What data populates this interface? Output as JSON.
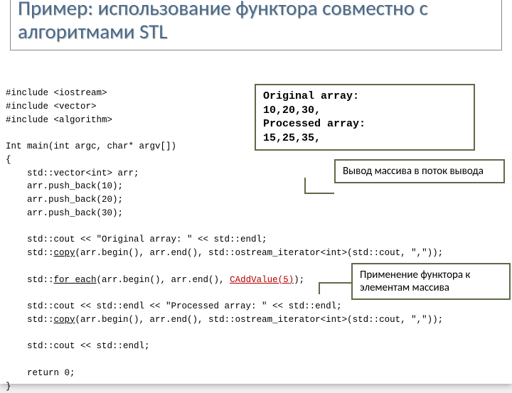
{
  "title": "Пример: использование функтора совместно с алгоритмами STL",
  "code": {
    "inc1": "#include <iostream>",
    "inc2": "#include <vector>",
    "inc3": "#include <algorithm>",
    "mainSig": "Int main(int argc, char* argv[])",
    "braceOpen": "{",
    "l1": "    std::vector<int> arr;",
    "l2": "    arr.push_back(10);",
    "l3": "    arr.push_back(20);",
    "l4": "    arr.push_back(30);",
    "l5": "    std::cout << \"Original array: \" << std::endl;",
    "l6a": "    std::",
    "l6b": "copy",
    "l6c": "(arr.begin(), arr.end(), std::ostream_iterator<int>(std::cout, \",\"));",
    "l7a": "    std::",
    "l7b": "for_each",
    "l7c": "(arr.begin(), arr.end(), ",
    "l7d": "CAddValue(5)",
    "l7e": ");",
    "l8": "    std::cout << std::endl << \"Processed array: \" << std::endl;",
    "l9a": "    std::",
    "l9b": "copy",
    "l9c": "(arr.begin(), arr.end(), std::ostream_iterator<int>(std::cout, \",\"));",
    "l10": "    std::cout << std::endl;",
    "ret": "    return 0;",
    "braceClose": "}"
  },
  "output": {
    "l1": "Original array:",
    "l2": "10,20,30,",
    "l3": "Processed array:",
    "l4": "15,25,35,"
  },
  "callout1": "Вывод массива в поток вывода",
  "callout2": "Применение функтора к элементам массива"
}
